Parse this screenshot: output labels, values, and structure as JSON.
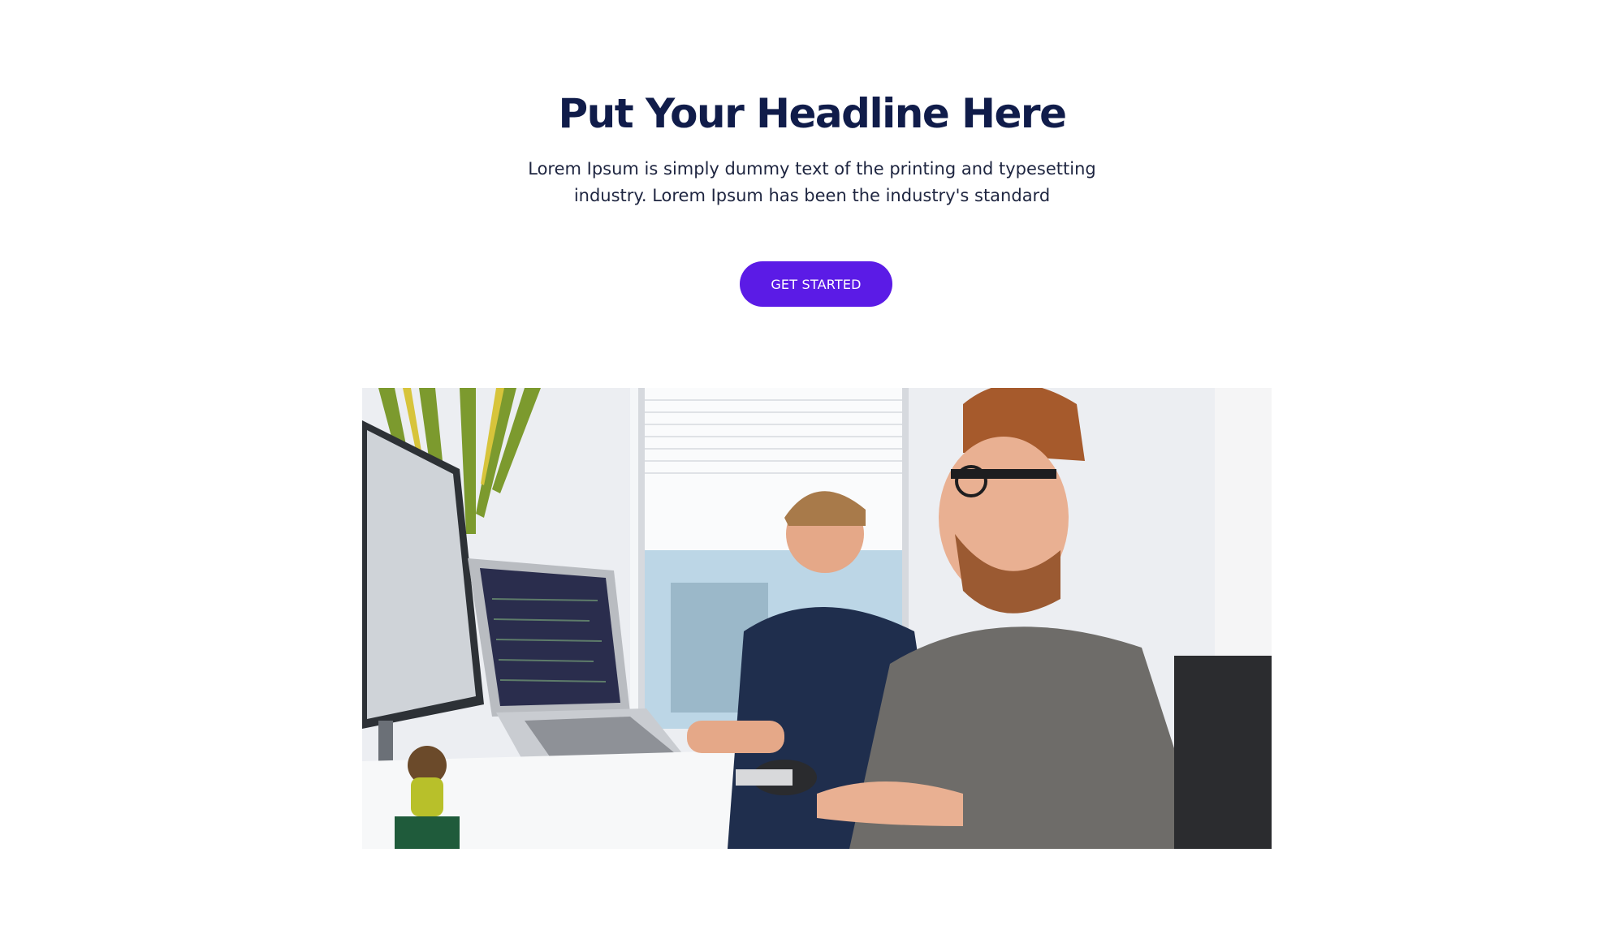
{
  "hero": {
    "headline": "Put Your Headline Here",
    "subtext_line1": "Lorem Ipsum is simply dummy text of the printing and typesetting",
    "subtext_line2": "industry. Lorem Ipsum has been the industry's standard",
    "cta_label": "GET STARTED"
  },
  "colors": {
    "headline": "#101c4a",
    "subtext": "#1e2540",
    "cta_background": "#5b1be6",
    "cta_text": "#ffffff",
    "background": "#ffffff"
  },
  "photo": {
    "subject": "office-workers-at-computers-photo"
  }
}
